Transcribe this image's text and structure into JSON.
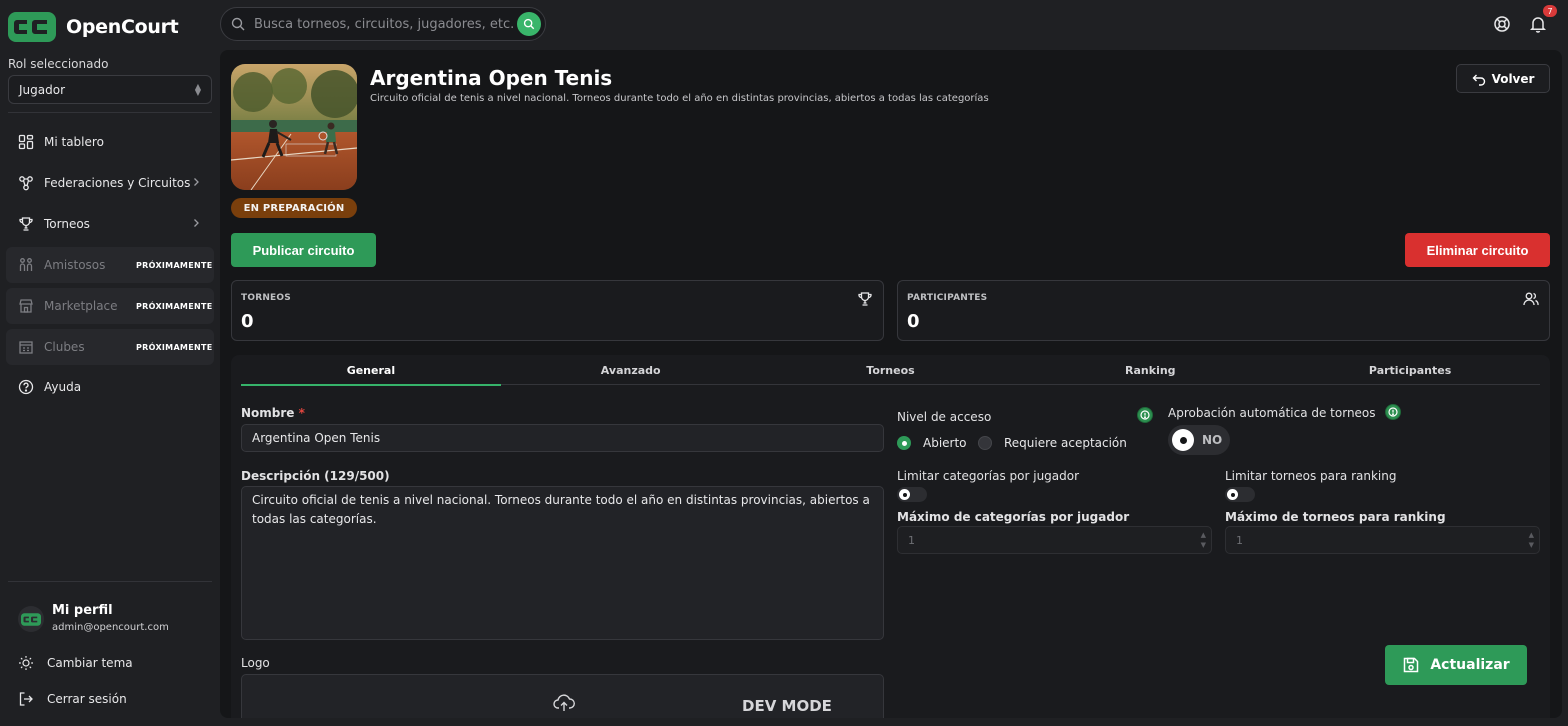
{
  "app": {
    "name": "OpenCourt"
  },
  "colors": {
    "accent": "#2e9a58",
    "danger": "#d9302f",
    "status_preparing": "#7a3f0c",
    "background": "#151618"
  },
  "sidebar": {
    "role_label": "Rol seleccionado",
    "role_value": "Jugador",
    "items": [
      {
        "label": "Mi tablero",
        "icon": "dashboard-icon"
      },
      {
        "label": "Federaciones y Circuitos",
        "icon": "network-icon"
      },
      {
        "label": "Torneos",
        "icon": "trophy-icon"
      },
      {
        "label": "Amistosos",
        "icon": "people-icon",
        "badge": "PRÓXIMAMENTE"
      },
      {
        "label": "Marketplace",
        "icon": "store-icon",
        "badge": "PRÓXIMAMENTE"
      },
      {
        "label": "Clubes",
        "icon": "building-icon",
        "badge": "PRÓXIMAMENTE"
      },
      {
        "label": "Ayuda",
        "icon": "help-icon"
      }
    ],
    "profile": {
      "name": "Mi perfil",
      "email": "admin@opencourt.com"
    },
    "theme_label": "Cambiar tema",
    "logout_label": "Cerrar sesión"
  },
  "topbar": {
    "search_placeholder": "Busca torneos, circuitos, jugadores, etc.",
    "notification_count": "7"
  },
  "circuit": {
    "title": "Argentina Open Tenis",
    "description": "Circuito oficial de tenis a nivel nacional. Torneos durante todo el año en distintas provincias, abiertos a todas las categorías",
    "status": "EN PREPARACIÓN",
    "back_label": "Volver",
    "publish_label": "Publicar circuito",
    "delete_label": "Eliminar circuito"
  },
  "stats": [
    {
      "label": "TORNEOS",
      "value": "0",
      "icon": "trophy-icon"
    },
    {
      "label": "PARTICIPANTES",
      "value": "0",
      "icon": "users-icon"
    }
  ],
  "tabs": [
    "General",
    "Avanzado",
    "Torneos",
    "Ranking",
    "Participantes"
  ],
  "form": {
    "name_label": "Nombre",
    "name_required": "*",
    "name_value": "Argentina Open Tenis",
    "description_label": "Descripción (129/500)",
    "description_value": "Circuito oficial de tenis a nivel nacional. Torneos durante todo el año en distintas provincias, abiertos a todas las categorías.",
    "logo_label": "Logo",
    "dev_mode": "DEV MODE",
    "access_label": "Nivel de acceso",
    "access_options": [
      "Abierto",
      "Requiere aceptación"
    ],
    "access_selected": "Abierto",
    "auto_approval_label": "Aprobación automática de torneos",
    "auto_approval_value": "NO",
    "limit_categories_label": "Limitar categorías por jugador",
    "limit_tournaments_label": "Limitar torneos para ranking",
    "max_categories_label": "Máximo de categorías por jugador",
    "max_categories_value": "1",
    "max_tournaments_label": "Máximo de torneos para ranking",
    "max_tournaments_value": "1",
    "save_label": "Actualizar"
  }
}
